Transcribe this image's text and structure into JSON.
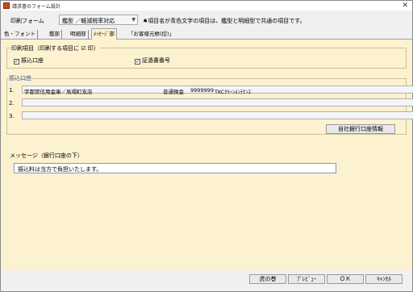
{
  "window": {
    "title": "請求書のフォーム設計",
    "close_glyph": "✕"
  },
  "header": {
    "form_label": "印刷フォーム",
    "form_select_value": "鑑型 ／軽減税率対応",
    "note": "♠項目名が青色文字の項目は、鑑型と明細型で共通の項目です。"
  },
  "tabs": [
    {
      "label": "色・フォント"
    },
    {
      "label": "鑑部"
    },
    {
      "label": "明細部"
    },
    {
      "label": "ﾒｯｾｰｼﾞ部"
    },
    {
      "label": "「お客様元帳(控)」"
    }
  ],
  "print_items": {
    "group_label": "印刷項目（印刷する項目に ☑ 印）",
    "check_mark": "✓",
    "checkboxes": [
      {
        "label": "振込口座",
        "checked": true
      },
      {
        "label": "証憑書番号",
        "checked": true
      }
    ]
  },
  "bank_accounts": {
    "group_label": "振込口座",
    "rows": [
      {
        "num": "1.",
        "bank": "宇都宮信用金庫／馬場町支店",
        "type": "普通預金",
        "number": "9999999",
        "holder": "TKCｸﾘｰﾝﾒﾝﾃﾅﾝｽ"
      },
      {
        "num": "2.",
        "bank": "",
        "type": "",
        "number": "",
        "holder": ""
      },
      {
        "num": "3.",
        "bank": "",
        "type": "",
        "number": "",
        "holder": ""
      }
    ],
    "company_bank_button": "自社銀行口座情報"
  },
  "message": {
    "label": "メッセージ（銀行口座の下）",
    "value": "振込料は当方で負担いたします。"
  },
  "footer": {
    "buttons": [
      {
        "label": "虎の巻"
      },
      {
        "label": "ﾌﾟﾚﾋﾞｭｰ"
      },
      {
        "label": "ＯＫ"
      },
      {
        "label": "ｷｬﾝｾﾙ"
      }
    ]
  },
  "colors": {
    "panel_bg": "#fdf2cf",
    "group_label_blue": "#1f4fa8",
    "app_icon": "#c94a1a"
  }
}
